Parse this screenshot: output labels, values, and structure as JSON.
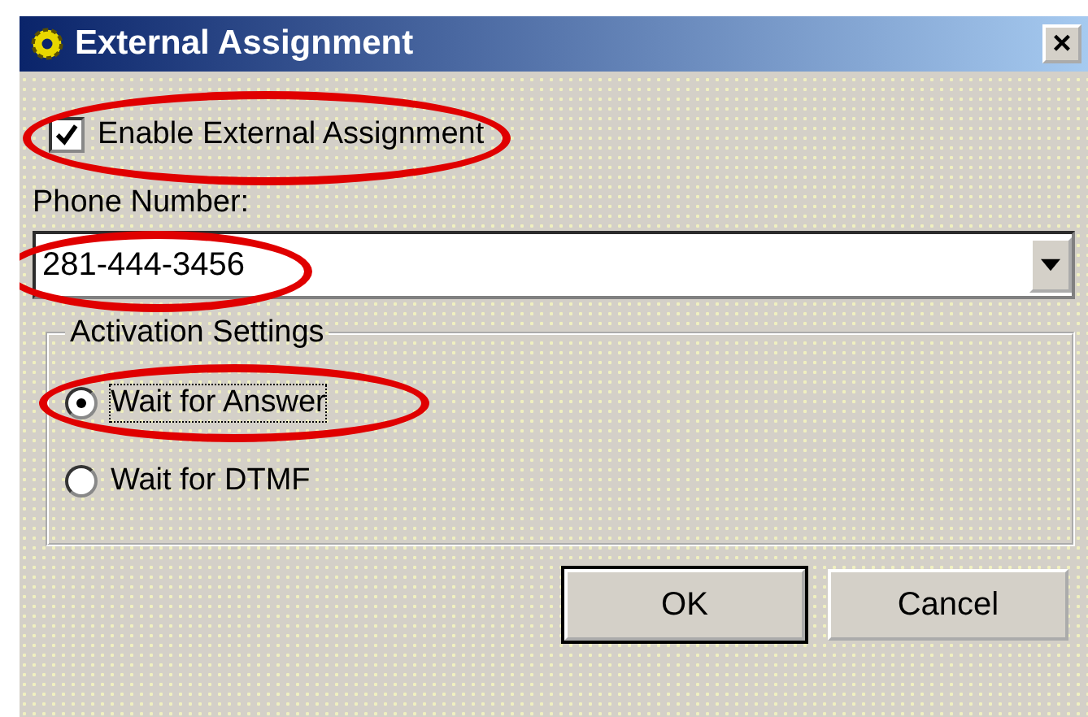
{
  "window": {
    "title": "External Assignment",
    "close": "×"
  },
  "enable_checkbox": {
    "label": "Enable External Assignment",
    "checked": true,
    "highlighted": true
  },
  "phone": {
    "label": "Phone Number:",
    "value": "281-444-3456",
    "highlighted": true
  },
  "activation_settings": {
    "title": "Activation Settings",
    "options": [
      {
        "label": "Wait for Answer",
        "selected": true,
        "highlighted": true
      },
      {
        "label": "Wait for DTMF",
        "selected": false,
        "highlighted": false
      }
    ]
  },
  "buttons": [
    {
      "label": "OK",
      "default": true
    },
    {
      "label": "Cancel",
      "default": false
    }
  ]
}
